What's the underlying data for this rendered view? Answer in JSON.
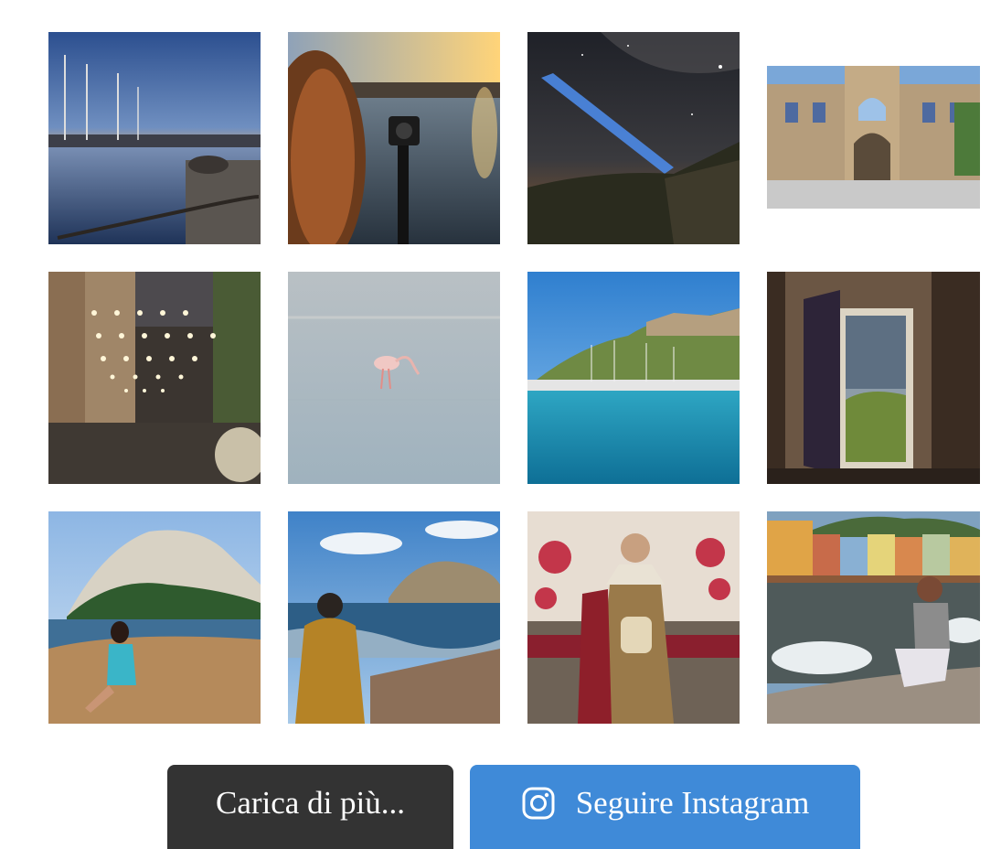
{
  "gallery": {
    "tiles": [
      {
        "name": "harbor-sunset-sailboats-photo",
        "theme": "harbor-sunset"
      },
      {
        "name": "gopro-lake-sunset-photo",
        "theme": "gopro-sunset"
      },
      {
        "name": "milky-way-flashlight-photo",
        "theme": "night-sky"
      },
      {
        "name": "historic-arch-building-photo",
        "theme": "arch-building"
      },
      {
        "name": "string-lights-street-photo",
        "theme": "street-lights"
      },
      {
        "name": "flamingo-in-water-photo",
        "theme": "flamingo"
      },
      {
        "name": "coastal-town-marina-photo",
        "theme": "marina"
      },
      {
        "name": "open-window-view-photo",
        "theme": "window"
      },
      {
        "name": "woman-on-beach-mountain-photo",
        "theme": "beach-mountain"
      },
      {
        "name": "man-looking-at-sea-photo",
        "theme": "man-sea"
      },
      {
        "name": "religious-statue-photo",
        "theme": "statue"
      },
      {
        "name": "woman-colorful-harbor-photo",
        "theme": "colorful-harbor"
      }
    ]
  },
  "actions": {
    "load_more_label": "Carica di più...",
    "follow_label": "Seguire Instagram",
    "follow_icon": "instagram-icon"
  },
  "colors": {
    "load_more_bg": "#333333",
    "follow_bg": "#3f8ad8",
    "button_text": "#ffffff"
  }
}
